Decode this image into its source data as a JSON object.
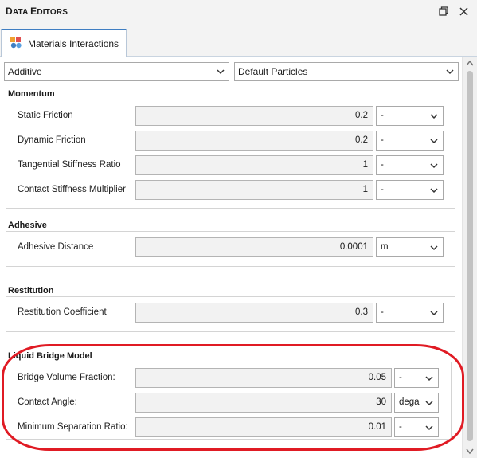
{
  "window": {
    "title_first": "D",
    "title_rest1": "ATA ",
    "title_first2": "E",
    "title_rest2": "DITORS",
    "restore_icon": "restore-icon",
    "close_icon": "close-icon"
  },
  "tabs": [
    {
      "label": "Materials Interactions",
      "icon": "materials-interactions-icon"
    }
  ],
  "selectors": {
    "mode": "Additive",
    "particles": "Default Particles"
  },
  "groups": {
    "momentum": {
      "title": "Momentum",
      "rows": [
        {
          "label": "Static Friction",
          "value": "0.2",
          "unit": "-"
        },
        {
          "label": "Dynamic Friction",
          "value": "0.2",
          "unit": "-"
        },
        {
          "label": "Tangential Stiffness Ratio",
          "value": "1",
          "unit": "-"
        },
        {
          "label": "Contact Stiffness Multiplier",
          "value": "1",
          "unit": "-"
        }
      ]
    },
    "adhesive": {
      "title": "Adhesive",
      "rows": [
        {
          "label": "Adhesive Distance",
          "value": "0.0001",
          "unit": "m"
        }
      ]
    },
    "restitution": {
      "title": "Restitution",
      "rows": [
        {
          "label": "Restitution Coefficient",
          "value": "0.3",
          "unit": "-"
        }
      ]
    },
    "liquid_bridge": {
      "title": "Liquid Bridge Model",
      "rows": [
        {
          "label": "Bridge Volume Fraction:",
          "value": "0.05",
          "unit": "-"
        },
        {
          "label": "Contact Angle:",
          "value": "30",
          "unit": "dega"
        },
        {
          "label": "Minimum Separation Ratio:",
          "value": "0.01",
          "unit": "-"
        }
      ]
    }
  },
  "annotation": {
    "color": "#e01b24"
  },
  "colors": {
    "tab_accent": "#3f7ec2"
  }
}
